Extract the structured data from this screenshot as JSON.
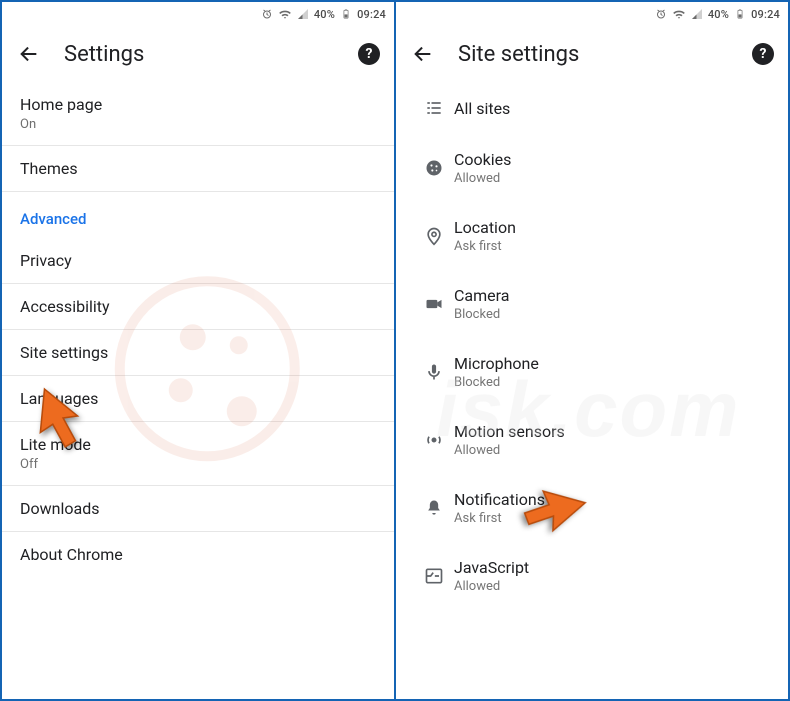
{
  "status": {
    "battery_pct": "40%",
    "time": "09:24"
  },
  "left": {
    "title": "Settings",
    "items": [
      {
        "label": "Home page",
        "sub": "On"
      },
      {
        "label": "Themes"
      },
      {
        "section": "Advanced"
      },
      {
        "label": "Privacy"
      },
      {
        "label": "Accessibility"
      },
      {
        "label": "Site settings"
      },
      {
        "label": "Languages"
      },
      {
        "label": "Lite mode",
        "sub": "Off"
      },
      {
        "label": "Downloads"
      },
      {
        "label": "About Chrome"
      }
    ]
  },
  "right": {
    "title": "Site settings",
    "items": [
      {
        "icon": "list",
        "label": "All sites"
      },
      {
        "icon": "cookie",
        "label": "Cookies",
        "sub": "Allowed"
      },
      {
        "icon": "location",
        "label": "Location",
        "sub": "Ask first"
      },
      {
        "icon": "camera",
        "label": "Camera",
        "sub": "Blocked"
      },
      {
        "icon": "mic",
        "label": "Microphone",
        "sub": "Blocked"
      },
      {
        "icon": "motion",
        "label": "Motion sensors",
        "sub": "Allowed"
      },
      {
        "icon": "bell",
        "label": "Notifications",
        "sub": "Ask first"
      },
      {
        "icon": "javascript",
        "label": "JavaScript",
        "sub": "Allowed"
      }
    ]
  }
}
